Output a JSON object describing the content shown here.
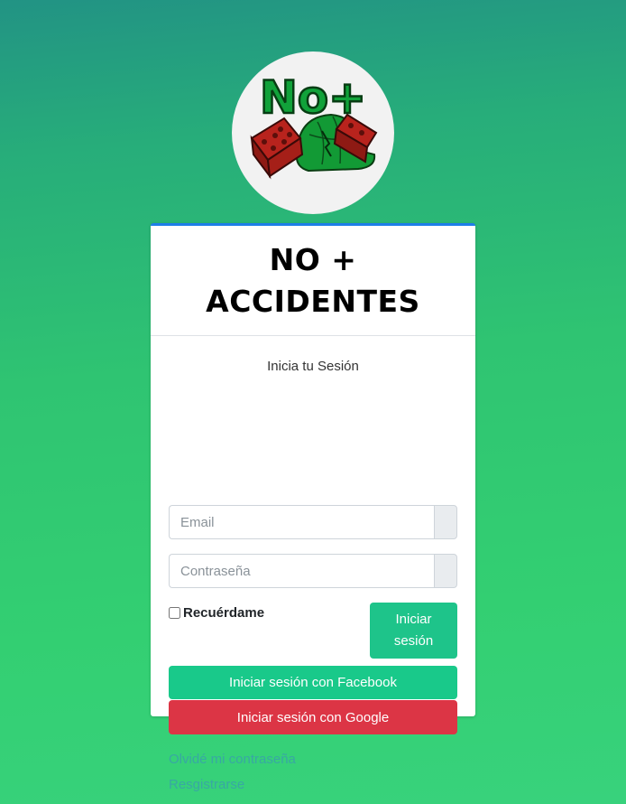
{
  "logo": {
    "text": "No+"
  },
  "header": {
    "title": "NO + ACCIDENTES"
  },
  "login": {
    "subtitle": "Inicia tu Sesión",
    "email_placeholder": "Email",
    "password_placeholder": "Contraseña",
    "remember_label": "Recuérdame",
    "login_button": "Iniciar sesión",
    "facebook_button": "Iniciar sesión con Facebook",
    "google_button": "Iniciar sesión con Google",
    "forgot_link": "Olvidé mi contraseña",
    "register_link": "Resgistrarse"
  },
  "colors": {
    "card_top_border": "#1e7ee8",
    "login_button": "#1ec48a",
    "facebook_button": "#19c98a",
    "google_button": "#dc3545",
    "link": "#38a8a3"
  }
}
